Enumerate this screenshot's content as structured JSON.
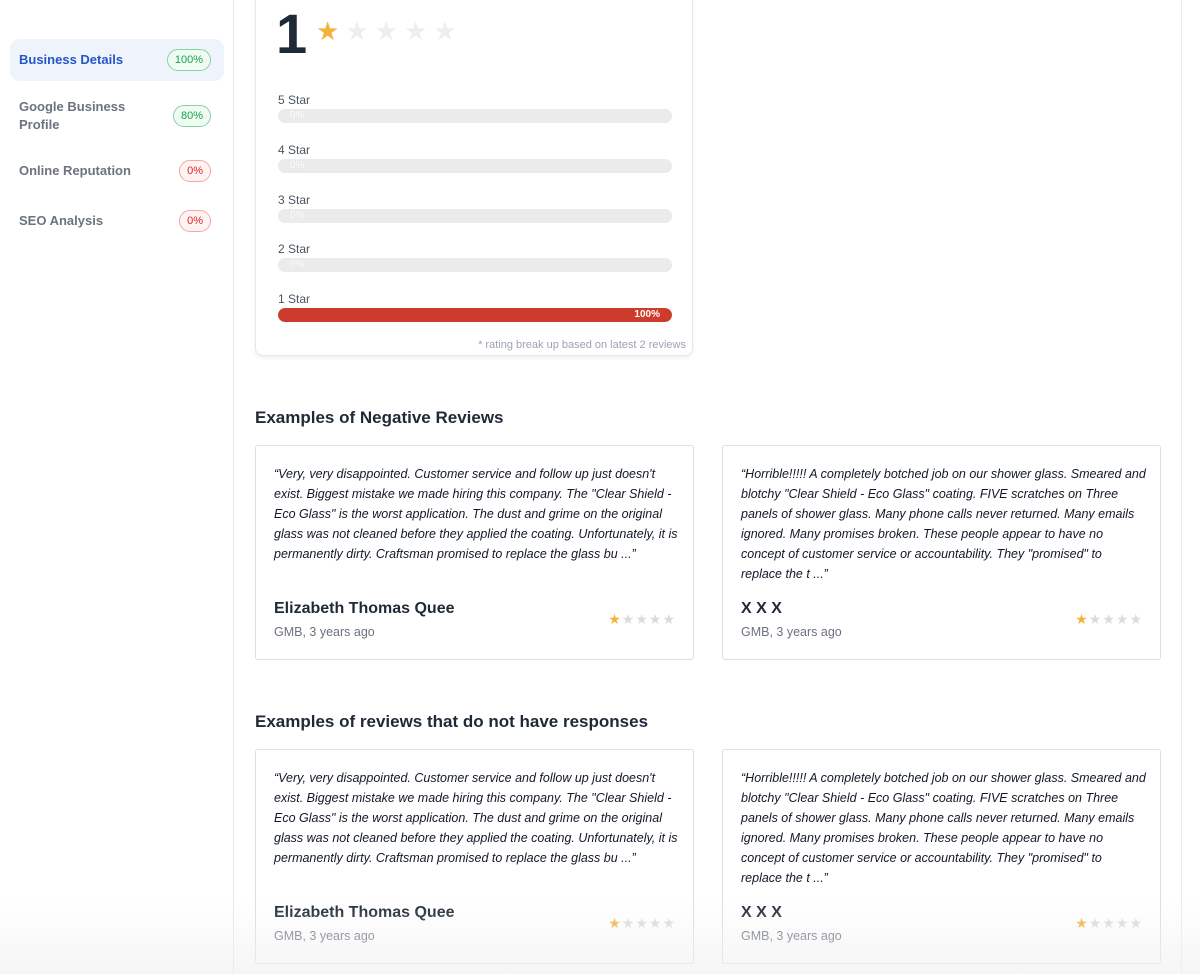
{
  "sidebar": {
    "items": [
      {
        "label": "Business Details",
        "badge": "100%"
      },
      {
        "label": "Google Business Profile",
        "badge": "80%"
      },
      {
        "label": "Online Reputation",
        "badge": "0%"
      },
      {
        "label": "SEO Analysis",
        "badge": "0%"
      }
    ]
  },
  "rating": {
    "score": "1",
    "stars_filled": 1,
    "stars_total": 5,
    "breakdown": [
      {
        "label": "5 Star",
        "percent_text": "0%",
        "percent": 0
      },
      {
        "label": "4 Star",
        "percent_text": "0%",
        "percent": 0
      },
      {
        "label": "3 Star",
        "percent_text": "0%",
        "percent": 0
      },
      {
        "label": "2 Star",
        "percent_text": "0%",
        "percent": 0
      },
      {
        "label": "1 Star",
        "percent_text": "100%",
        "percent": 100
      }
    ],
    "note": "* rating break up based on latest 2 reviews"
  },
  "negative_reviews": {
    "title": "Examples of Negative Reviews",
    "items": [
      {
        "text": "“Very, very disappointed. Customer service and follow up just doesn't exist. Biggest mistake we made hiring this company. The \"Clear Shield - Eco Glass\" is the worst application. The dust and grime on the original glass was not cleaned before they applied the coating. Unfortunately, it is permanently dirty. Craftsman promised to replace the glass bu ...”",
        "author": "Elizabeth Thomas Quee",
        "meta": "GMB, 3 years ago",
        "stars": 1
      },
      {
        "text": "“Horrible!!!!! A completely botched job on our shower glass. Smeared and blotchy \"Clear Shield - Eco Glass\" coating. FIVE scratches on Three panels of shower glass. Many phone calls never returned. Many emails ignored. Many promises broken. These people appear to have no concept of customer service or accountability. They \"promised\" to replace the t ...”",
        "author": "X X X",
        "meta": "GMB, 3 years ago",
        "stars": 1
      }
    ]
  },
  "no_response_reviews": {
    "title": "Examples of reviews that do not have responses",
    "items": [
      {
        "text": "“Very, very disappointed. Customer service and follow up just doesn't exist. Biggest mistake we made hiring this company. The \"Clear Shield - Eco Glass\" is the worst application. The dust and grime on the original glass was not cleaned before they applied the coating. Unfortunately, it is permanently dirty. Craftsman promised to replace the glass bu ...”",
        "author": "Elizabeth Thomas Quee",
        "meta": "GMB, 3 years ago",
        "stars": 1
      },
      {
        "text": "“Horrible!!!!! A completely botched job on our shower glass. Smeared and blotchy \"Clear Shield - Eco Glass\" coating. FIVE scratches on Three panels of shower glass. Many phone calls never returned. Many emails ignored. Many promises broken. These people appear to have no concept of customer service or accountability. They \"promised\" to replace the t ...”",
        "author": "X X X",
        "meta": "GMB, 3 years ago",
        "stars": 1
      }
    ]
  },
  "colors": {
    "star": "#f2b33d",
    "bar_fill": "#cc3b2b",
    "active_nav": "#2457c5"
  }
}
